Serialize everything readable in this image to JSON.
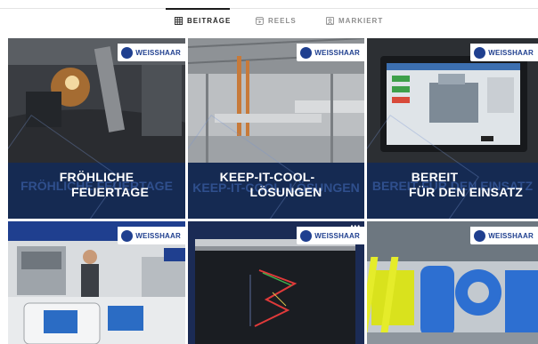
{
  "tabs": [
    {
      "label": "BEITRÄGE",
      "icon": "grid-icon",
      "active": true
    },
    {
      "label": "REELS",
      "icon": "reels-icon",
      "active": false
    },
    {
      "label": "MARKIERT",
      "icon": "tagged-icon",
      "active": false
    }
  ],
  "brand": {
    "logo_text": "WEISSHAAR"
  },
  "posts": [
    {
      "caption_lines": [
        "FRÖHLICHE",
        "FEUERTAGE"
      ],
      "ghost_text": "FRÖHLICHE FEUERTAGE",
      "photo": "welding"
    },
    {
      "caption_lines": [
        "KEEP-IT-COOL-",
        "LÖSUNGEN"
      ],
      "ghost_text": "KEEP-IT-COOL- LÖSUNGEN",
      "photo": "ductwork"
    },
    {
      "caption_lines": [
        "BEREIT",
        "FÜR DEN EINSATZ"
      ],
      "ghost_text": "BEREIT FÜR DEN EINSATZ",
      "photo": "control-panel"
    },
    {
      "caption_lines": [],
      "photo": "trade-fair-booth"
    },
    {
      "caption_lines": [],
      "photo": "cad-screen"
    },
    {
      "caption_lines": [],
      "photo": "hashtag-letters"
    }
  ]
}
